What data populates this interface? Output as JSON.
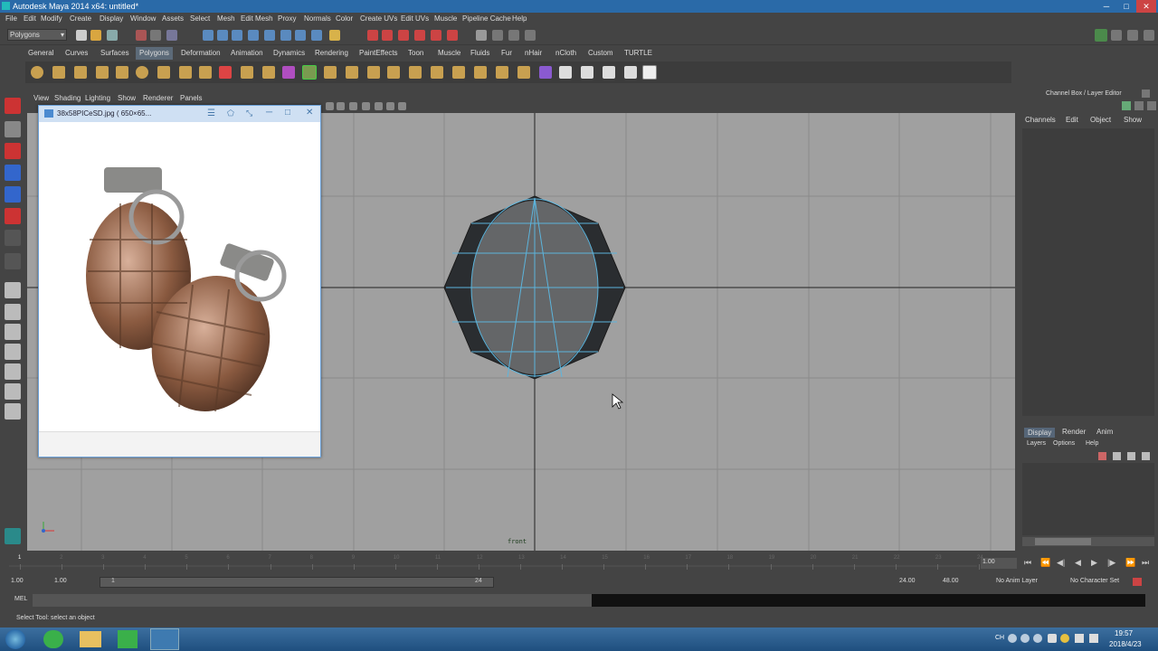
{
  "window": {
    "title": "Autodesk Maya 2014 x64: untitled*"
  },
  "menus": [
    "File",
    "Edit",
    "Modify",
    "Create",
    "Display",
    "Window",
    "Assets",
    "Select",
    "Mesh",
    "Edit Mesh",
    "Proxy",
    "Normals",
    "Color",
    "Create UVs",
    "Edit UVs",
    "Muscle",
    "Pipeline Cache",
    "Help"
  ],
  "status": {
    "mode": "Polygons"
  },
  "shelf_tabs": [
    "General",
    "Curves",
    "Surfaces",
    "Polygons",
    "Deformation",
    "Animation",
    "Dynamics",
    "Rendering",
    "PaintEffects",
    "Toon",
    "Muscle",
    "Fluids",
    "Fur",
    "nHair",
    "nCloth",
    "Custom",
    "TURTLE"
  ],
  "panel_menu": [
    "View",
    "Shading",
    "Lighting",
    "Show",
    "Renderer",
    "Panels"
  ],
  "viewport": {
    "camera": "front"
  },
  "image_window": {
    "title": "38x58PICeSD.jpg ( 650×65..."
  },
  "channel_box": {
    "caption": "Channel Box / Layer Editor",
    "menu": [
      "Channels",
      "Edit",
      "Object",
      "Show"
    ],
    "layer_tabs": [
      "Display",
      "Render",
      "Anim"
    ],
    "layer_menu": [
      "Layers",
      "Options",
      "Help"
    ]
  },
  "time": {
    "ticks": [
      "1",
      "2",
      "3",
      "4",
      "5",
      "6",
      "7",
      "8",
      "9",
      "10",
      "11",
      "12",
      "13",
      "14",
      "15",
      "16",
      "17",
      "18",
      "19",
      "20",
      "21",
      "22",
      "23",
      "24"
    ],
    "current": "1.00",
    "range_start": "1.00",
    "range_start2": "1.00",
    "range_mark": "1",
    "range_end_mark": "24",
    "range_end": "24.00",
    "range_end2": "48.00",
    "anim_layer": "No Anim Layer",
    "char_set": "No Character Set"
  },
  "cmd": {
    "label": "MEL"
  },
  "help_line": "Select Tool: select an object",
  "taskbar": {
    "time": "19:57",
    "date": "2018/4/23",
    "lang": "CH"
  }
}
